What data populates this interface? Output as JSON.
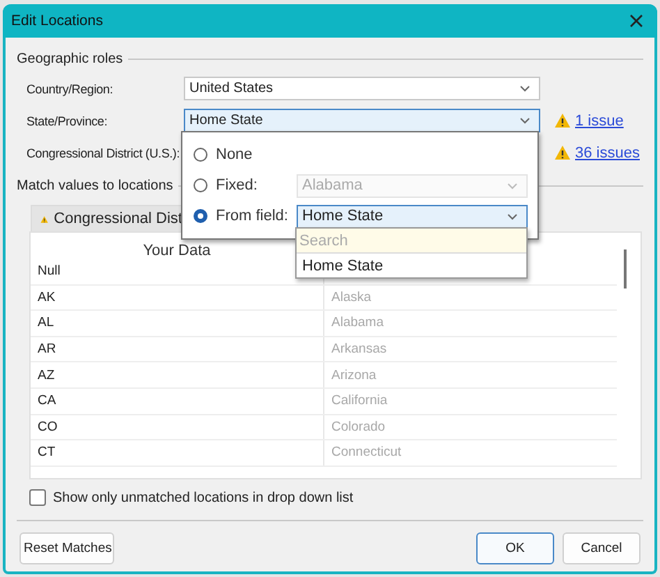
{
  "window": {
    "title": "Edit Locations"
  },
  "geographic_roles": {
    "title": "Geographic roles",
    "rows": [
      {
        "label": "Country/Region:",
        "value": "United States",
        "focused": false
      },
      {
        "label": "State/Province:",
        "value": "Home State",
        "focused": true,
        "issue": "1 issue"
      },
      {
        "label": "Congressional District (U.S.):",
        "issue": "36 issues"
      }
    ]
  },
  "role_popup": {
    "options": [
      {
        "label": "None",
        "selected": false
      },
      {
        "label": "Fixed:",
        "selected": false,
        "value": "Alabama",
        "disabled": true
      },
      {
        "label": "From field:",
        "selected": true,
        "value": "Home State",
        "disabled": false
      }
    ],
    "dropdown": {
      "search_placeholder": "Search",
      "items": [
        "Home State"
      ]
    }
  },
  "match": {
    "title": "Match values to locations",
    "tab": "Congressional Dist",
    "column": "Your Data",
    "rows": [
      {
        "data": "Null"
      },
      {
        "data": "AK",
        "match": "Alaska"
      },
      {
        "data": "AL",
        "match": "Alabama"
      },
      {
        "data": "AR",
        "match": "Arkansas"
      },
      {
        "data": "AZ",
        "match": "Arizona"
      },
      {
        "data": "CA",
        "match": "California"
      },
      {
        "data": "CO",
        "match": "Colorado"
      },
      {
        "data": "CT",
        "match": "Connecticut"
      }
    ]
  },
  "show_unmatched": {
    "label": "Show only unmatched locations in drop down list",
    "checked": false
  },
  "buttons": [
    {
      "label": "Reset Matches",
      "default": false
    },
    {
      "label": "OK",
      "default": true
    },
    {
      "label": "Cancel",
      "default": false
    }
  ]
}
